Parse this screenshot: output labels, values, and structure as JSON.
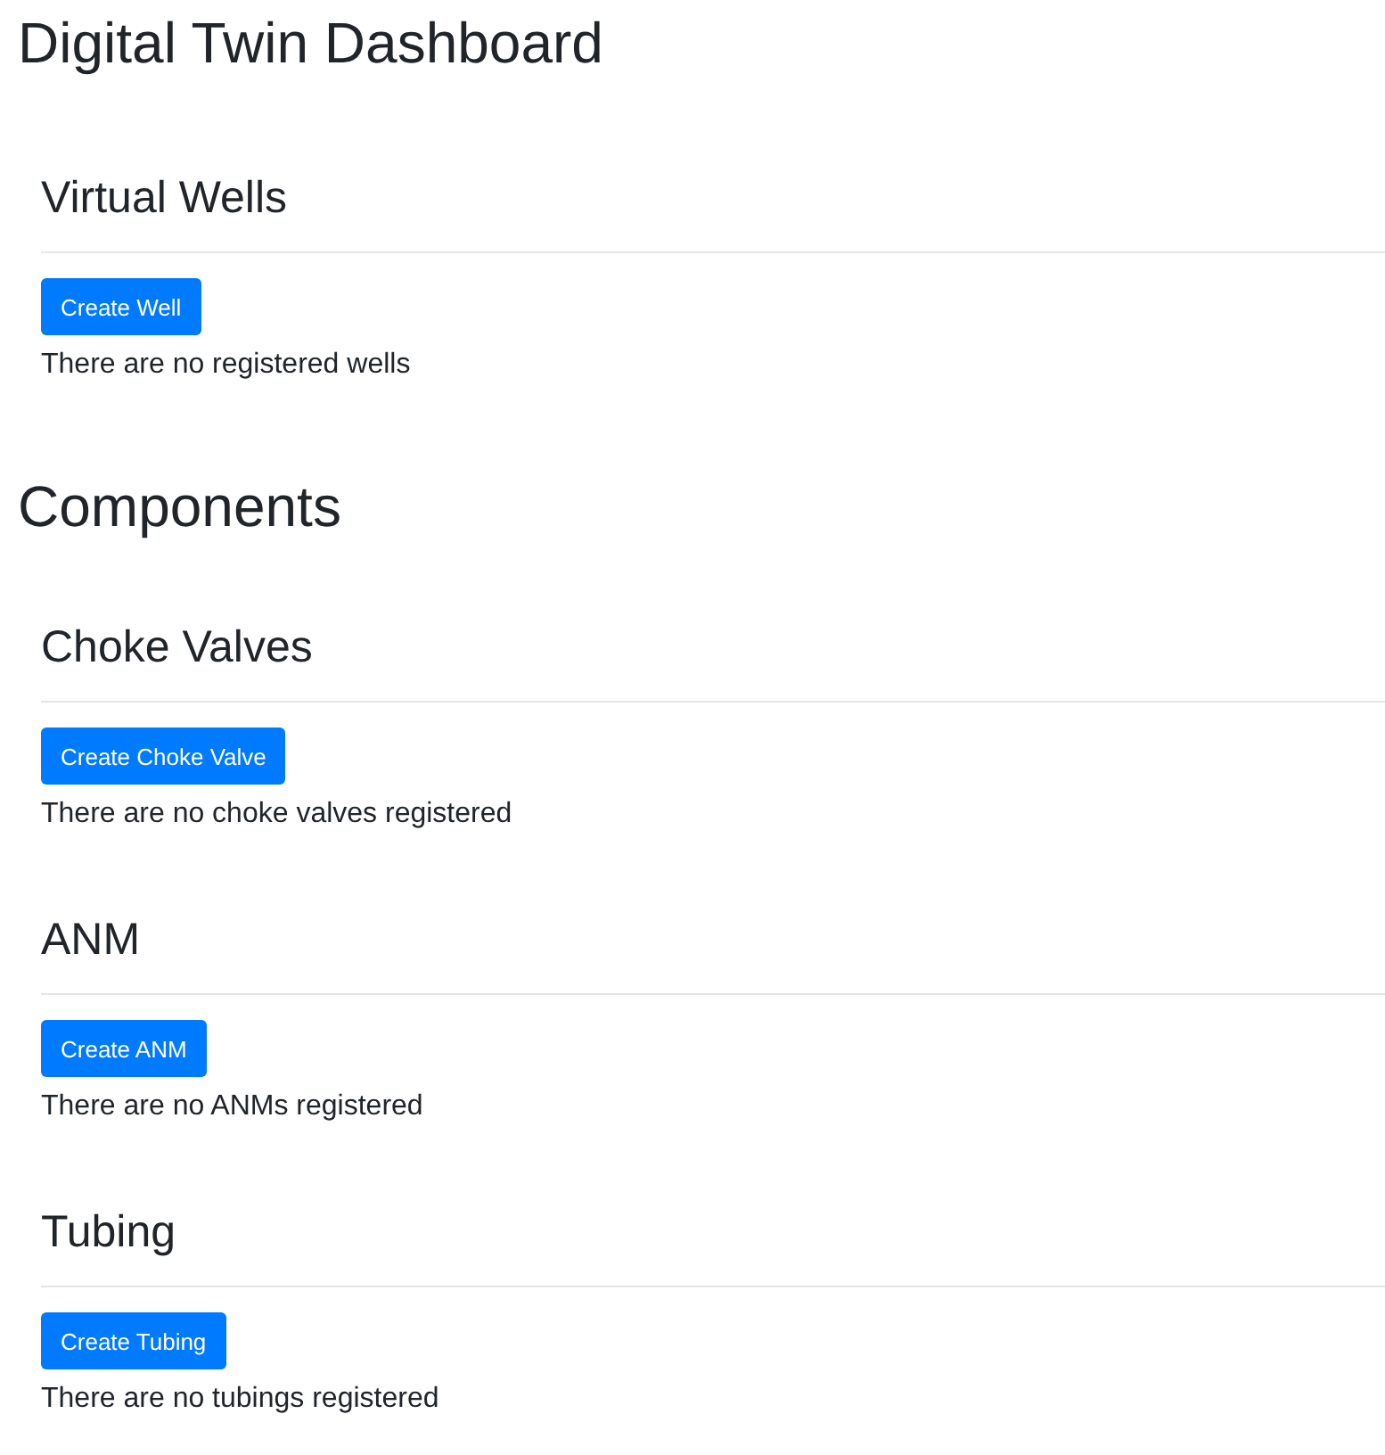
{
  "title": "Digital Twin Dashboard",
  "wells": {
    "heading": "Virtual Wells",
    "button": "Create Well",
    "message": "There are no registered wells"
  },
  "components": {
    "heading": "Components",
    "sections": [
      {
        "heading": "Choke Valves",
        "button": "Create Choke Valve",
        "message": "There are no choke valves registered"
      },
      {
        "heading": "ANM",
        "button": "Create ANM",
        "message": "There are no ANMs registered"
      },
      {
        "heading": "Tubing",
        "button": "Create Tubing",
        "message": "There are no tubings registered"
      }
    ]
  }
}
